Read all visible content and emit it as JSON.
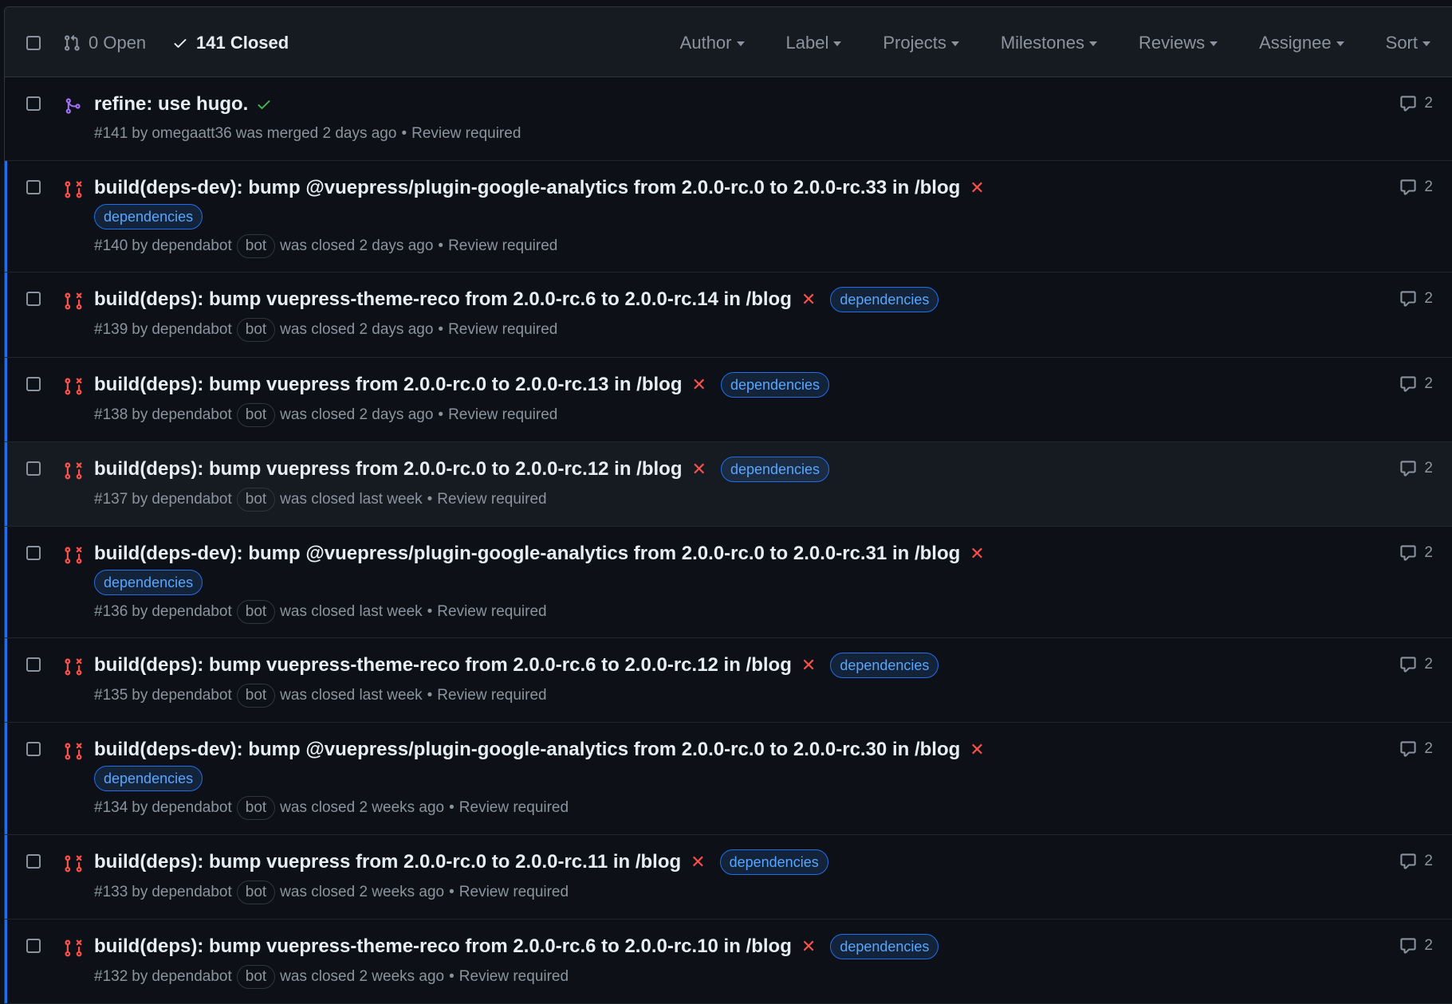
{
  "header": {
    "open_label": "0 Open",
    "closed_label": "141 Closed",
    "filters": [
      "Author",
      "Label",
      "Projects",
      "Milestones",
      "Reviews",
      "Assignee",
      "Sort"
    ]
  },
  "colors": {
    "merged": "#a371f7",
    "closed": "#f85149",
    "success": "#3fb950",
    "label_text": "#58a6ff",
    "accent_bar": "#1f6feb"
  },
  "pulls": [
    {
      "title": "refine: use hugo.",
      "state": "merged",
      "status": "success",
      "number": "#141",
      "by": "by",
      "author": "omegaatt36",
      "bot": "",
      "action": "was merged 2 days ago",
      "review": "Review required",
      "label": "",
      "label_wrap": false,
      "comments": "2"
    },
    {
      "title": "build(deps-dev): bump @vuepress/plugin-google-analytics from 2.0.0-rc.0 to 2.0.0-rc.33 in /blog",
      "state": "closed",
      "status": "fail",
      "number": "#140",
      "by": "by",
      "author": "dependabot",
      "bot": "bot",
      "action": "was closed 2 days ago",
      "review": "Review required",
      "label": "dependencies",
      "label_wrap": true,
      "comments": "2"
    },
    {
      "title": "build(deps): bump vuepress-theme-reco from 2.0.0-rc.6 to 2.0.0-rc.14 in /blog",
      "state": "closed",
      "status": "fail",
      "number": "#139",
      "by": "by",
      "author": "dependabot",
      "bot": "bot",
      "action": "was closed 2 days ago",
      "review": "Review required",
      "label": "dependencies",
      "label_wrap": false,
      "comments": "2"
    },
    {
      "title": "build(deps): bump vuepress from 2.0.0-rc.0 to 2.0.0-rc.13 in /blog",
      "state": "closed",
      "status": "fail",
      "number": "#138",
      "by": "by",
      "author": "dependabot",
      "bot": "bot",
      "action": "was closed 2 days ago",
      "review": "Review required",
      "label": "dependencies",
      "label_wrap": false,
      "comments": "2"
    },
    {
      "title": "build(deps): bump vuepress from 2.0.0-rc.0 to 2.0.0-rc.12 in /blog",
      "state": "closed",
      "status": "fail",
      "number": "#137",
      "by": "by",
      "author": "dependabot",
      "bot": "bot",
      "action": "was closed last week",
      "review": "Review required",
      "label": "dependencies",
      "label_wrap": false,
      "comments": "2"
    },
    {
      "title": "build(deps-dev): bump @vuepress/plugin-google-analytics from 2.0.0-rc.0 to 2.0.0-rc.31 in /blog",
      "state": "closed",
      "status": "fail",
      "number": "#136",
      "by": "by",
      "author": "dependabot",
      "bot": "bot",
      "action": "was closed last week",
      "review": "Review required",
      "label": "dependencies",
      "label_wrap": true,
      "comments": "2"
    },
    {
      "title": "build(deps): bump vuepress-theme-reco from 2.0.0-rc.6 to 2.0.0-rc.12 in /blog",
      "state": "closed",
      "status": "fail",
      "number": "#135",
      "by": "by",
      "author": "dependabot",
      "bot": "bot",
      "action": "was closed last week",
      "review": "Review required",
      "label": "dependencies",
      "label_wrap": false,
      "comments": "2"
    },
    {
      "title": "build(deps-dev): bump @vuepress/plugin-google-analytics from 2.0.0-rc.0 to 2.0.0-rc.30 in /blog",
      "state": "closed",
      "status": "fail",
      "number": "#134",
      "by": "by",
      "author": "dependabot",
      "bot": "bot",
      "action": "was closed 2 weeks ago",
      "review": "Review required",
      "label": "dependencies",
      "label_wrap": true,
      "comments": "2"
    },
    {
      "title": "build(deps): bump vuepress from 2.0.0-rc.0 to 2.0.0-rc.11 in /blog",
      "state": "closed",
      "status": "fail",
      "number": "#133",
      "by": "by",
      "author": "dependabot",
      "bot": "bot",
      "action": "was closed 2 weeks ago",
      "review": "Review required",
      "label": "dependencies",
      "label_wrap": false,
      "comments": "2"
    },
    {
      "title": "build(deps): bump vuepress-theme-reco from 2.0.0-rc.6 to 2.0.0-rc.10 in /blog",
      "state": "closed",
      "status": "fail",
      "number": "#132",
      "by": "by",
      "author": "dependabot",
      "bot": "bot",
      "action": "was closed 2 weeks ago",
      "review": "Review required",
      "label": "dependencies",
      "label_wrap": false,
      "comments": "2"
    }
  ]
}
